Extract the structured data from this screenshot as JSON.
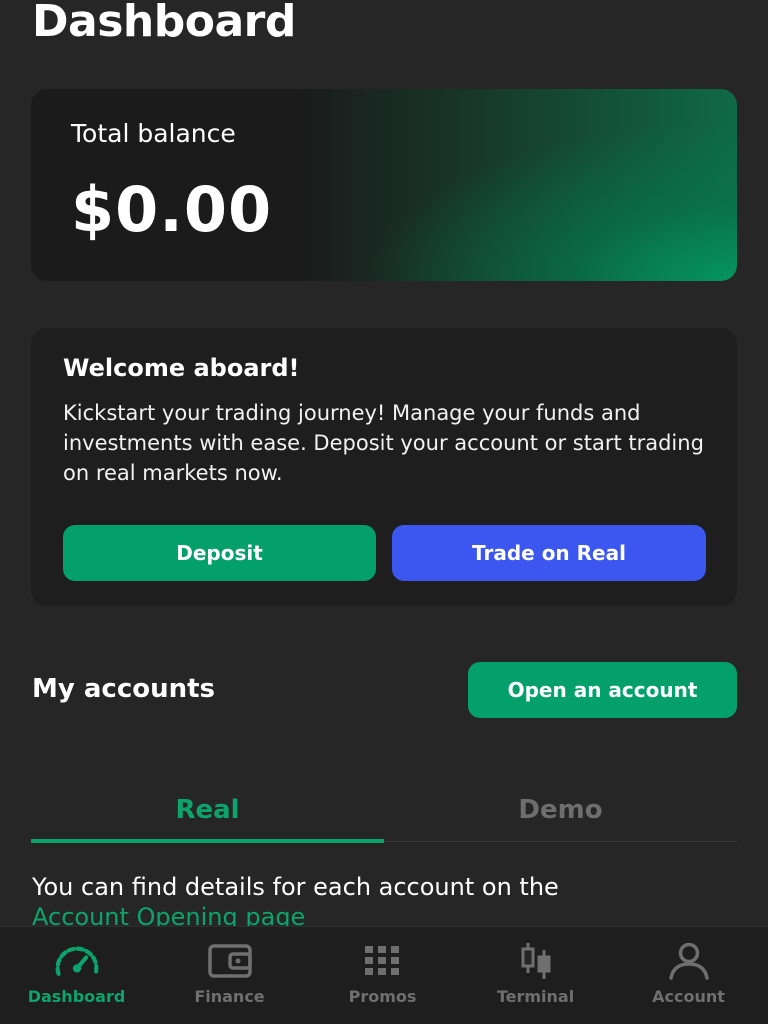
{
  "header": {
    "title": "Dashboard"
  },
  "balance": {
    "label": "Total balance",
    "value": "$0.00"
  },
  "welcome": {
    "title": "Welcome aboard!",
    "text": "Kickstart your trading journey! Manage your funds and investments with ease. Deposit your account or start trading on real markets now.",
    "deposit_label": "Deposit",
    "trade_label": "Trade on Real"
  },
  "accounts": {
    "title": "My accounts",
    "open_label": "Open an account",
    "tabs": [
      {
        "label": "Real",
        "active": true
      },
      {
        "label": "Demo",
        "active": false
      }
    ],
    "info_text": "You can find details for each account on the",
    "info_link": "Account Opening page"
  },
  "bottom_nav": {
    "items": [
      {
        "label": "Dashboard",
        "icon": "speedometer-icon",
        "active": true
      },
      {
        "label": "Finance",
        "icon": "wallet-icon",
        "active": false
      },
      {
        "label": "Promos",
        "icon": "grid-icon",
        "active": false
      },
      {
        "label": "Terminal",
        "icon": "candlestick-icon",
        "active": false
      },
      {
        "label": "Account",
        "icon": "user-icon",
        "active": false
      }
    ]
  },
  "colors": {
    "background": "#262626",
    "card": "#1e1e1e",
    "accent_green": "#04a06b",
    "accent_blue": "#3c57f0",
    "muted": "#6f6f6f"
  }
}
